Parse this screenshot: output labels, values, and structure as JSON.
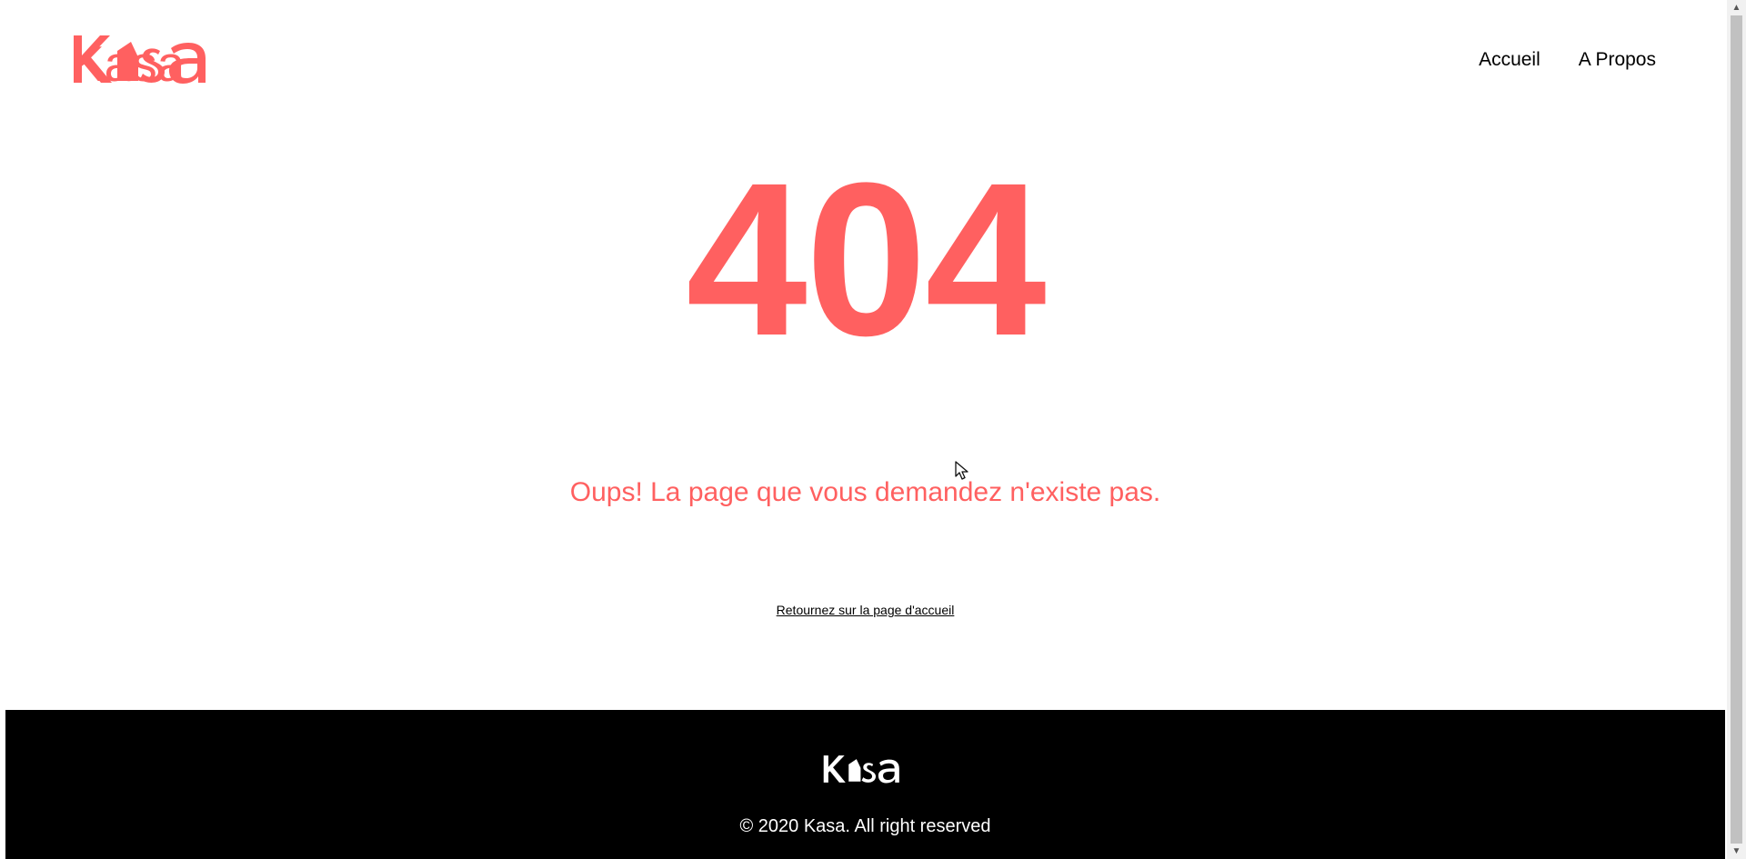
{
  "app": {
    "brand": "Kasa",
    "accent_color": "#FF6060",
    "footer_background": "#000000"
  },
  "header": {
    "logo_text": "Kasa",
    "logo_icon": "house-icon",
    "nav": {
      "home": "Accueil",
      "about": "A Propos"
    }
  },
  "main": {
    "error_code": "404",
    "message": "Oups! La page que vous demandez n'existe pas.",
    "home_link": "Retournez sur la page d'accueil"
  },
  "footer": {
    "logo_text": "Kasa",
    "logo_icon": "house-icon",
    "copyright": "© 2020 Kasa. All right reserved"
  },
  "scrollbar": {
    "up_icon": "arrow-up-icon",
    "down_icon": "arrow-down-icon",
    "thumb": "scrollbar-thumb"
  }
}
